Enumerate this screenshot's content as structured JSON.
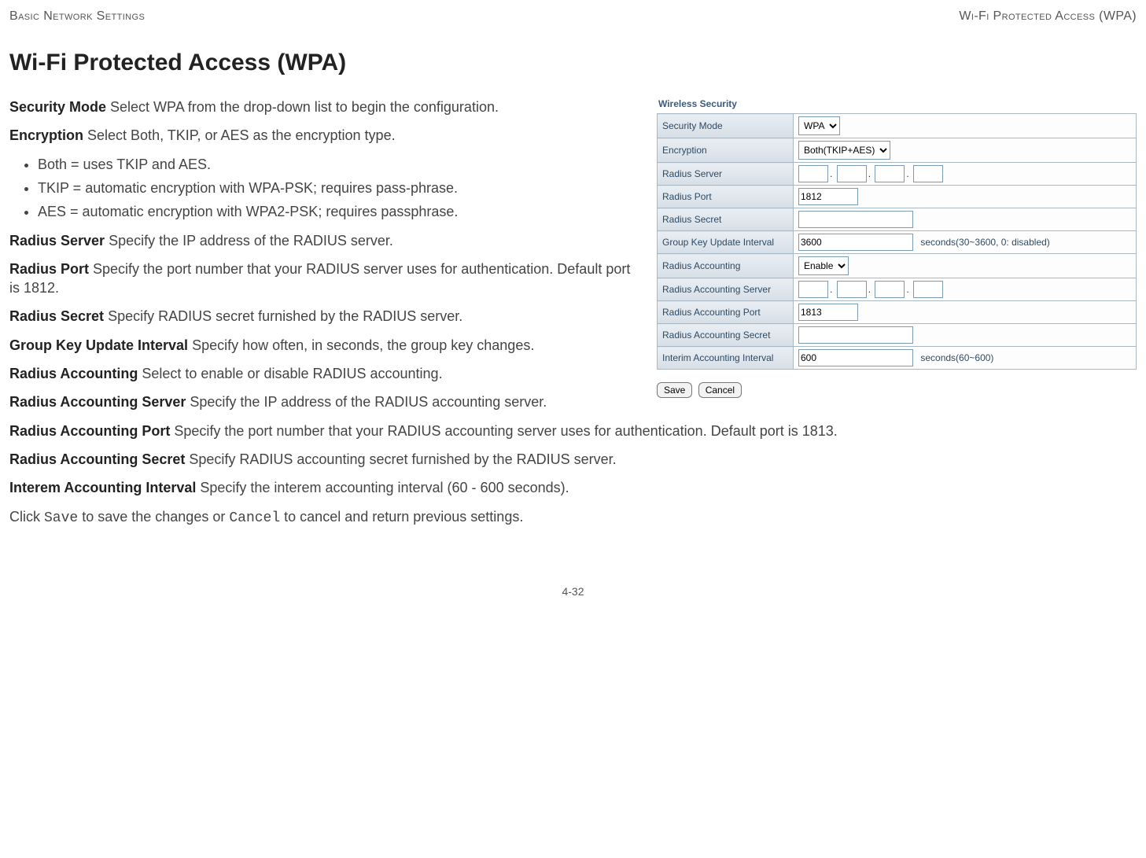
{
  "header": {
    "left": "Basic Network Settings",
    "right": "Wi-Fi Protected Access (WPA)"
  },
  "title": "Wi-Fi Protected Access (WPA)",
  "defs": {
    "securityMode": {
      "lead": "Security Mode",
      "text": "  Select WPA from the drop-down list to begin the configuration."
    },
    "encryption": {
      "lead": "Encryption",
      "text": "  Select Both, TKIP, or AES as the encryption type."
    },
    "bullets": [
      "Both = uses TKIP and AES.",
      "TKIP = automatic encryption with WPA-PSK; requires pass-phrase.",
      "AES = automatic encryption with WPA2-PSK; requires passphrase."
    ],
    "radiusServer": {
      "lead": "Radius Server",
      "text": "  Specify the IP address of the RADIUS server."
    },
    "radiusPort": {
      "lead": "Radius Port",
      "text": "  Specify the port number that your RADIUS server uses for authentication. Default port is 1812."
    },
    "radiusSecret": {
      "lead": "Radius Secret",
      "text": "  Specify RADIUS secret furnished by the RADIUS server."
    },
    "groupKey": {
      "lead": "Group Key Update Interval",
      "text": "  Specify how often, in seconds, the group key changes."
    },
    "radiusAcct": {
      "lead": "Radius Accounting",
      "text": "  Select to enable or disable RADIUS accounting."
    },
    "radiusAcctSrv": {
      "lead": "Radius Accounting Server",
      "text": "  Specify the IP address of the RADIUS accounting server."
    },
    "radiusAcctPort": {
      "lead": "Radius Accounting Port",
      "text": "  Specify the port number that your RADIUS accounting server uses for authentication. Default port is 1813."
    },
    "radiusAcctSec": {
      "lead": "Radius Accounting Secret",
      "text": "  Specify RADIUS accounting secret furnished by the RADIUS server."
    },
    "interim": {
      "lead": "Interem Accounting Interval",
      "text": "  Specify the interem accounting interval (60 - 600 seconds)."
    }
  },
  "closing": {
    "pre": "Click ",
    "save": "Save",
    "mid": " to save the changes or ",
    "cancel": "Cancel",
    "post": " to cancel and return previous settings."
  },
  "footer": "4-32",
  "fig": {
    "title": "Wireless Security",
    "rows": {
      "securityMode": {
        "label": "Security Mode",
        "value": "WPA"
      },
      "encryption": {
        "label": "Encryption",
        "value": "Both(TKIP+AES)"
      },
      "radiusServer": {
        "label": "Radius Server"
      },
      "radiusPort": {
        "label": "Radius Port",
        "value": "1812"
      },
      "radiusSecret": {
        "label": "Radius Secret"
      },
      "groupKey": {
        "label": "Group Key Update Interval",
        "value": "3600",
        "hint": "seconds(30~3600, 0: disabled)"
      },
      "radiusAcct": {
        "label": "Radius Accounting",
        "value": "Enable"
      },
      "radiusAcctSrv": {
        "label": "Radius Accounting Server"
      },
      "radiusAcctPort": {
        "label": "Radius Accounting Port",
        "value": "1813"
      },
      "radiusAcctSec": {
        "label": "Radius Accounting Secret"
      },
      "interim": {
        "label": "Interim Accounting Interval",
        "value": "600",
        "hint": "seconds(60~600)"
      }
    },
    "buttons": {
      "save": "Save",
      "cancel": "Cancel"
    }
  }
}
